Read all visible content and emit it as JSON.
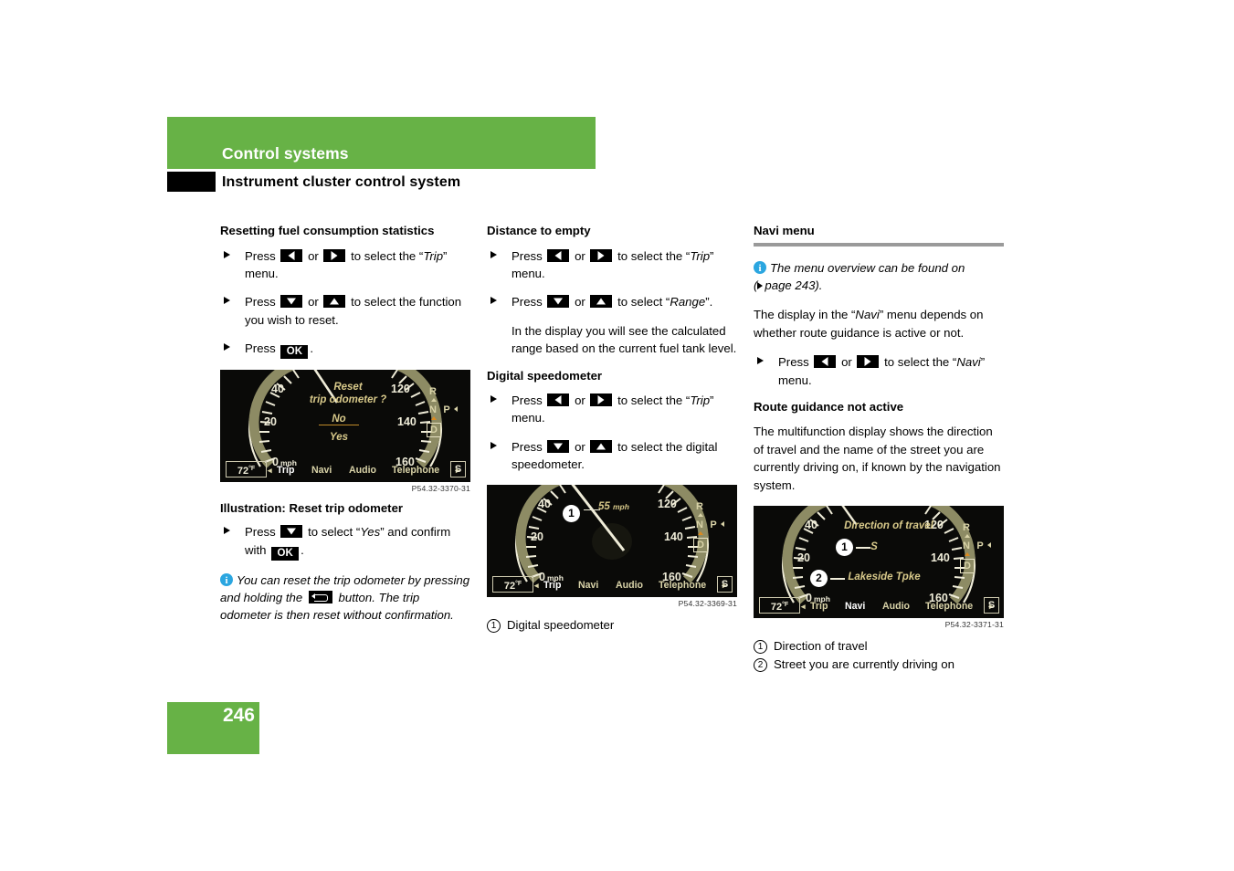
{
  "header": {
    "chapter": "Control systems",
    "section": "Instrument cluster control system"
  },
  "page_number": "246",
  "colors": {
    "accent_green": "#67b246",
    "rule_gray": "#9a9a9a",
    "info_blue": "#2ba6e0",
    "display_amber": "#d8c98a",
    "display_cream": "#efecd8"
  },
  "column1": {
    "heading": "Resetting fuel consumption statistics",
    "step1_a": "Press",
    "step1_or": "or",
    "step1_b": "to select the “",
    "step1_trip": "Trip",
    "step1_c": "” menu.",
    "step2_a": "Press",
    "step2_or": "or",
    "step2_b": "to select the function you wish to reset.",
    "step3_a": "Press",
    "step3_ok": "OK",
    "step3_b": ".",
    "figure_code": "P54.32-3370-31",
    "figure_caption": "Illustration: Reset trip odometer",
    "step4_a": "Press",
    "step4_b": "to select “",
    "step4_yes": "Yes",
    "step4_c": "” and confirm with",
    "step4_ok": "OK",
    "step4_d": ".",
    "note_a": "You can reset the trip odometer by pressing and holding the",
    "note_b": "button. The trip odometer is then reset without confirmation."
  },
  "column2": {
    "heading1": "Distance to empty",
    "step1_a": "Press",
    "step1_or": "or",
    "step1_b": "to select the “",
    "step1_trip": "Trip",
    "step1_c": "” menu.",
    "step2_a": "Press",
    "step2_or": "or",
    "step2_b": "to select “",
    "step2_range": "Range",
    "step2_c": "”.",
    "step2_cont": "In the display you will see the calculated range based on the current fuel tank level.",
    "heading2": "Digital speedometer",
    "step3_a": "Press",
    "step3_or": "or",
    "step3_b": "to select the “",
    "step3_trip": "Trip",
    "step3_c": "” menu.",
    "step4_a": "Press",
    "step4_or": "or",
    "step4_b": "to select the digital speedometer.",
    "figure_code": "P54.32-3369-31",
    "callout1_num": "1",
    "callout1": "Digital speedometer"
  },
  "column3": {
    "heading1": "Navi menu",
    "note_a": "The menu overview can be found on",
    "note_ref": "page 243).",
    "note_paren": "(",
    "para1": "The display in the “Navi” menu depends on whether route guidance is active or not.",
    "para1_pre": "The display in the “",
    "para1_em": "Navi",
    "para1_post": "” menu depends on whether route guidance is active or not.",
    "step1_a": "Press",
    "step1_or": "or",
    "step1_b": "to select the “",
    "step1_navi": "Navi",
    "step1_c": "” menu.",
    "heading2": "Route guidance not active",
    "para2": "The multifunction display shows the direction of travel and the name of the street you are currently driving on, if known by the navigation system.",
    "figure_code": "P54.32-3371-31",
    "callout1_num": "1",
    "callout1": "Direction of travel",
    "callout2_num": "2",
    "callout2": "Street you are currently driving on"
  },
  "cluster": {
    "temp": "72",
    "temp_unit": "°F",
    "scale_left": [
      "40",
      "20",
      "0"
    ],
    "scale_left_unit": "mph",
    "scale_right": [
      "120",
      "140",
      "160"
    ],
    "menu_items": [
      "Trip",
      "Navi",
      "Audio",
      "Telephone"
    ],
    "menu_left_arrow": "◂",
    "menu_right_arrow": "▸",
    "s_badge": "S",
    "gear_R": "R",
    "gear_N": "N",
    "gear_P": "P",
    "gear_D": "D"
  },
  "figure1": {
    "line1": "Reset",
    "line2": "trip odometer ?",
    "option_no": "No",
    "option_yes": "Yes",
    "active_menu": "Trip"
  },
  "figure2": {
    "speed": "55",
    "speed_unit": "mph",
    "marker1": "1",
    "active_menu": "Trip"
  },
  "figure3": {
    "line1": "Direction of travel",
    "direction": "S",
    "street": "Lakeside Tpke",
    "marker1": "1",
    "marker2": "2",
    "active_menu": "Navi"
  }
}
